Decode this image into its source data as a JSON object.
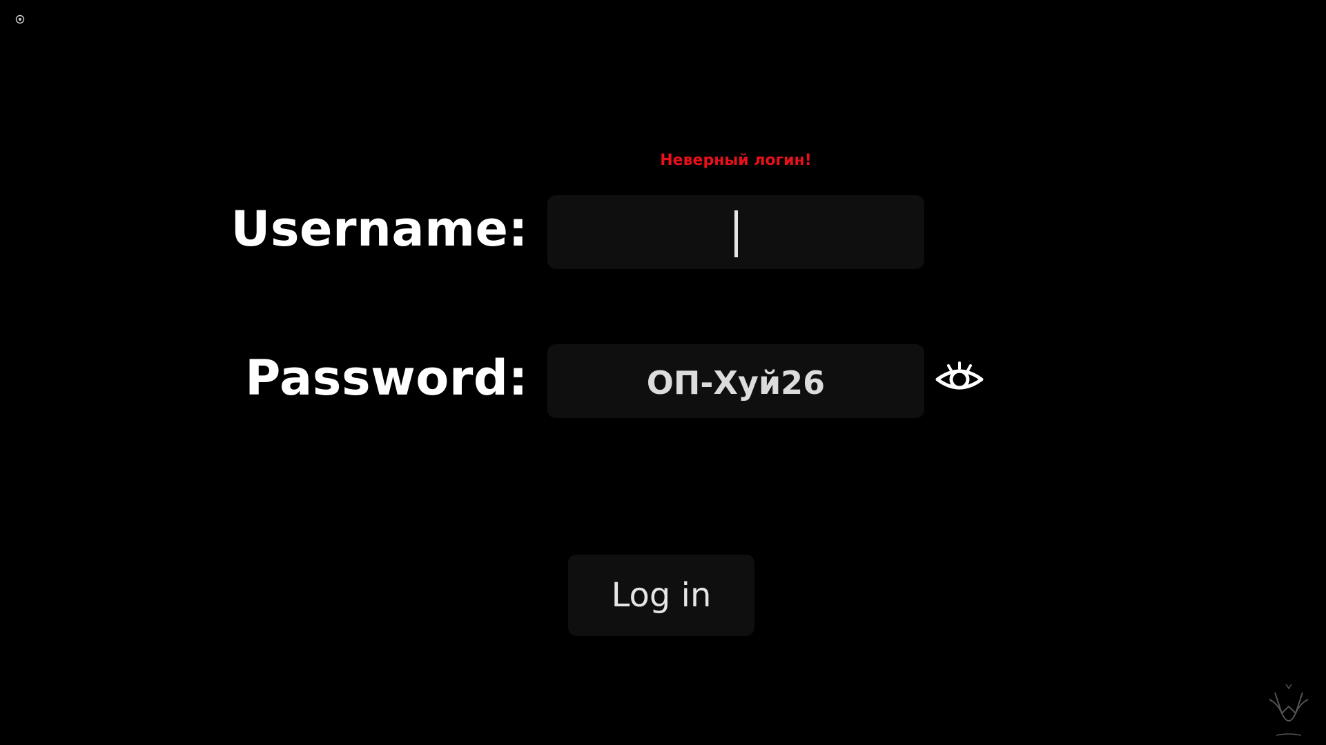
{
  "form": {
    "error_message": "Неверный логин!",
    "username": {
      "label": "Username:",
      "value": ""
    },
    "password": {
      "label": "Password:",
      "value": "ОП-Хуй26"
    },
    "login_button_label": "Log in"
  },
  "icons": {
    "corner": "target-icon",
    "password_toggle": "eye-icon",
    "watermark": "logo-watermark"
  },
  "colors": {
    "background": "#000000",
    "field_background": "#0f0f0f",
    "error": "#e8101a",
    "text": "#ffffff"
  }
}
